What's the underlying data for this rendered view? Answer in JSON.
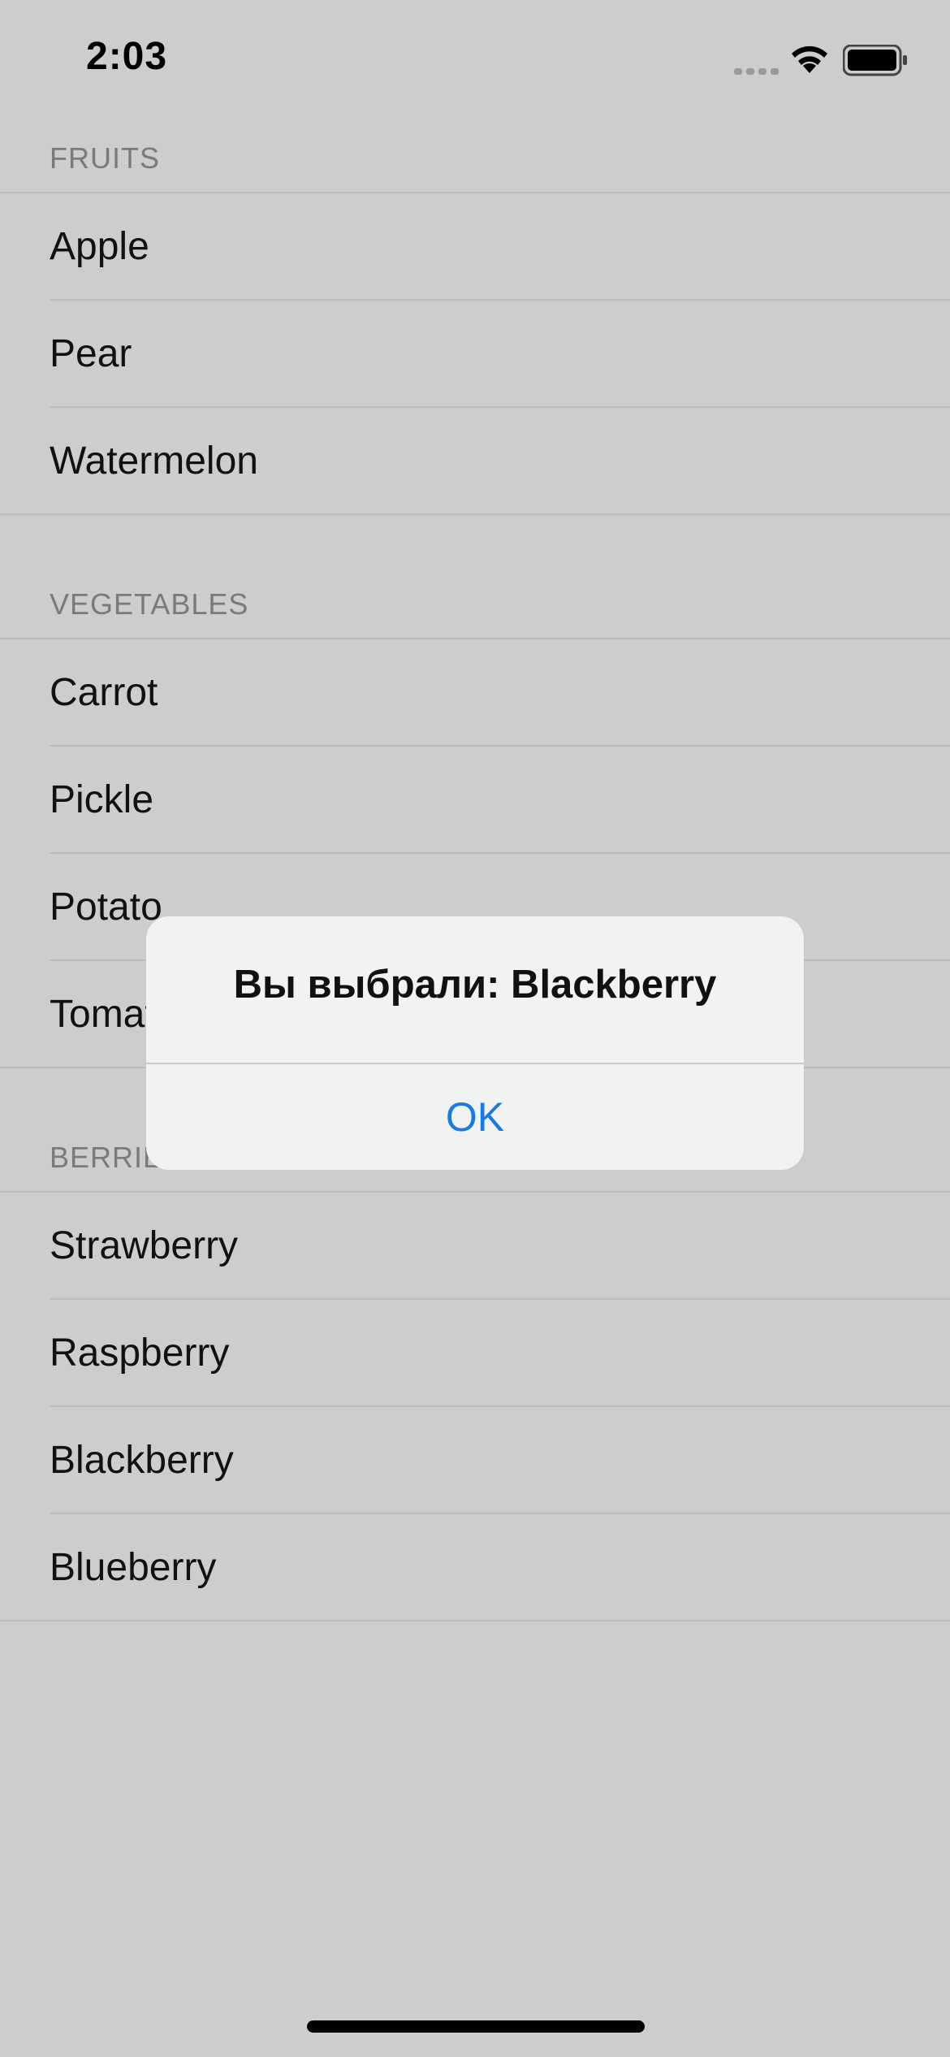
{
  "status_bar": {
    "time": "2:03"
  },
  "sections": [
    {
      "header": "FRUITS",
      "items": [
        "Apple",
        "Pear",
        "Watermelon"
      ]
    },
    {
      "header": "VEGETABLES",
      "items": [
        "Carrot",
        "Pickle",
        "Potato",
        "Tomato"
      ]
    },
    {
      "header": "BERRIES",
      "items": [
        "Strawberry",
        "Raspberry",
        "Blackberry",
        "Blueberry"
      ]
    }
  ],
  "alert": {
    "title": "Вы выбрали: Blackberry",
    "button": "OK",
    "accent": "#1a7ae0"
  }
}
